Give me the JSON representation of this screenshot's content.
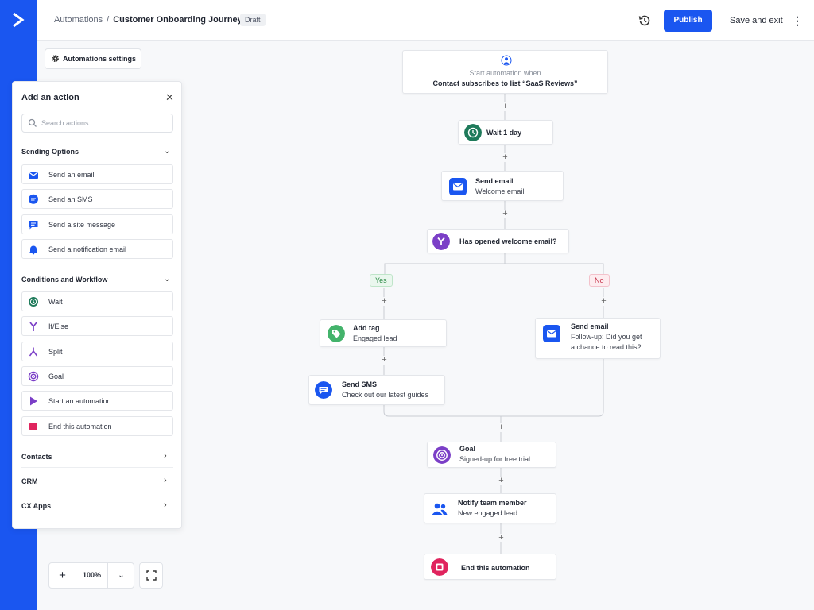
{
  "header": {
    "breadcrumb_root": "Automations",
    "breadcrumb_sep": "/",
    "title": "Customer Onboarding Journey",
    "status_badge": "Draft",
    "publish_label": "Publish",
    "save_exit_label": "Save and exit",
    "history_icon": "history-icon",
    "more_icon": "more-vertical-icon"
  },
  "settings_button": {
    "label": "Automations settings",
    "icon": "gear-icon"
  },
  "panel": {
    "title": "Add an action",
    "search_placeholder": "Search actions...",
    "sending": {
      "heading": "Sending Options",
      "items": [
        {
          "label": "Send an email",
          "icon": "email-icon"
        },
        {
          "label": "Send an SMS",
          "icon": "sms-icon"
        },
        {
          "label": "Send a site message",
          "icon": "site-message-icon"
        },
        {
          "label": "Send a notification email",
          "icon": "bell-icon"
        }
      ]
    },
    "conditions": {
      "heading": "Conditions and Workflow",
      "items": [
        {
          "label": "Wait",
          "icon": "clock-icon"
        },
        {
          "label": "If/Else",
          "icon": "branch-icon"
        },
        {
          "label": "Split",
          "icon": "split-icon"
        },
        {
          "label": "Goal",
          "icon": "target-icon"
        },
        {
          "label": "Start an automation",
          "icon": "play-icon"
        },
        {
          "label": "End this automation",
          "icon": "stop-icon"
        }
      ]
    },
    "categories": [
      {
        "label": "Contacts"
      },
      {
        "label": "CRM"
      },
      {
        "label": "CX Apps"
      }
    ]
  },
  "zoom": {
    "level": "100%"
  },
  "flow": {
    "trigger": {
      "line1": "Start automation when",
      "line2": "Contact subscribes to list “SaaS Reviews”",
      "icon": "user-icon"
    },
    "wait": {
      "title": "Wait 1 day",
      "icon": "clock-icon"
    },
    "send_email": {
      "title": "Send email",
      "subtitle": "Welcome email",
      "icon": "email-icon"
    },
    "condition": {
      "title": "Has opened welcome email?",
      "icon": "branch-icon"
    },
    "yes_label": "Yes",
    "no_label": "No",
    "add_tag": {
      "title": "Add tag",
      "subtitle": "Engaged lead",
      "icon": "tag-icon"
    },
    "followup": {
      "title": "Send email",
      "line1": "Follow-up: Did you get",
      "line2": "a chance to read this?",
      "icon": "email-icon"
    },
    "send_sms": {
      "title": "Send SMS",
      "subtitle": "Check out our latest guides",
      "icon": "sms-icon"
    },
    "goal": {
      "title": "Goal",
      "subtitle": "Signed-up for free trial",
      "icon": "target-icon"
    },
    "notify": {
      "title": "Notify team member",
      "subtitle": "New engaged lead",
      "icon": "team-icon"
    },
    "end": {
      "title": "End this automation",
      "icon": "stop-icon"
    },
    "plus_symbol": "+"
  },
  "colors": {
    "brand_blue": "#1a56f0",
    "wait_green": "#1e7a5a",
    "condition_purple": "#7b3fc7",
    "tag_green": "#43b36b",
    "end_red": "#e0245e"
  }
}
